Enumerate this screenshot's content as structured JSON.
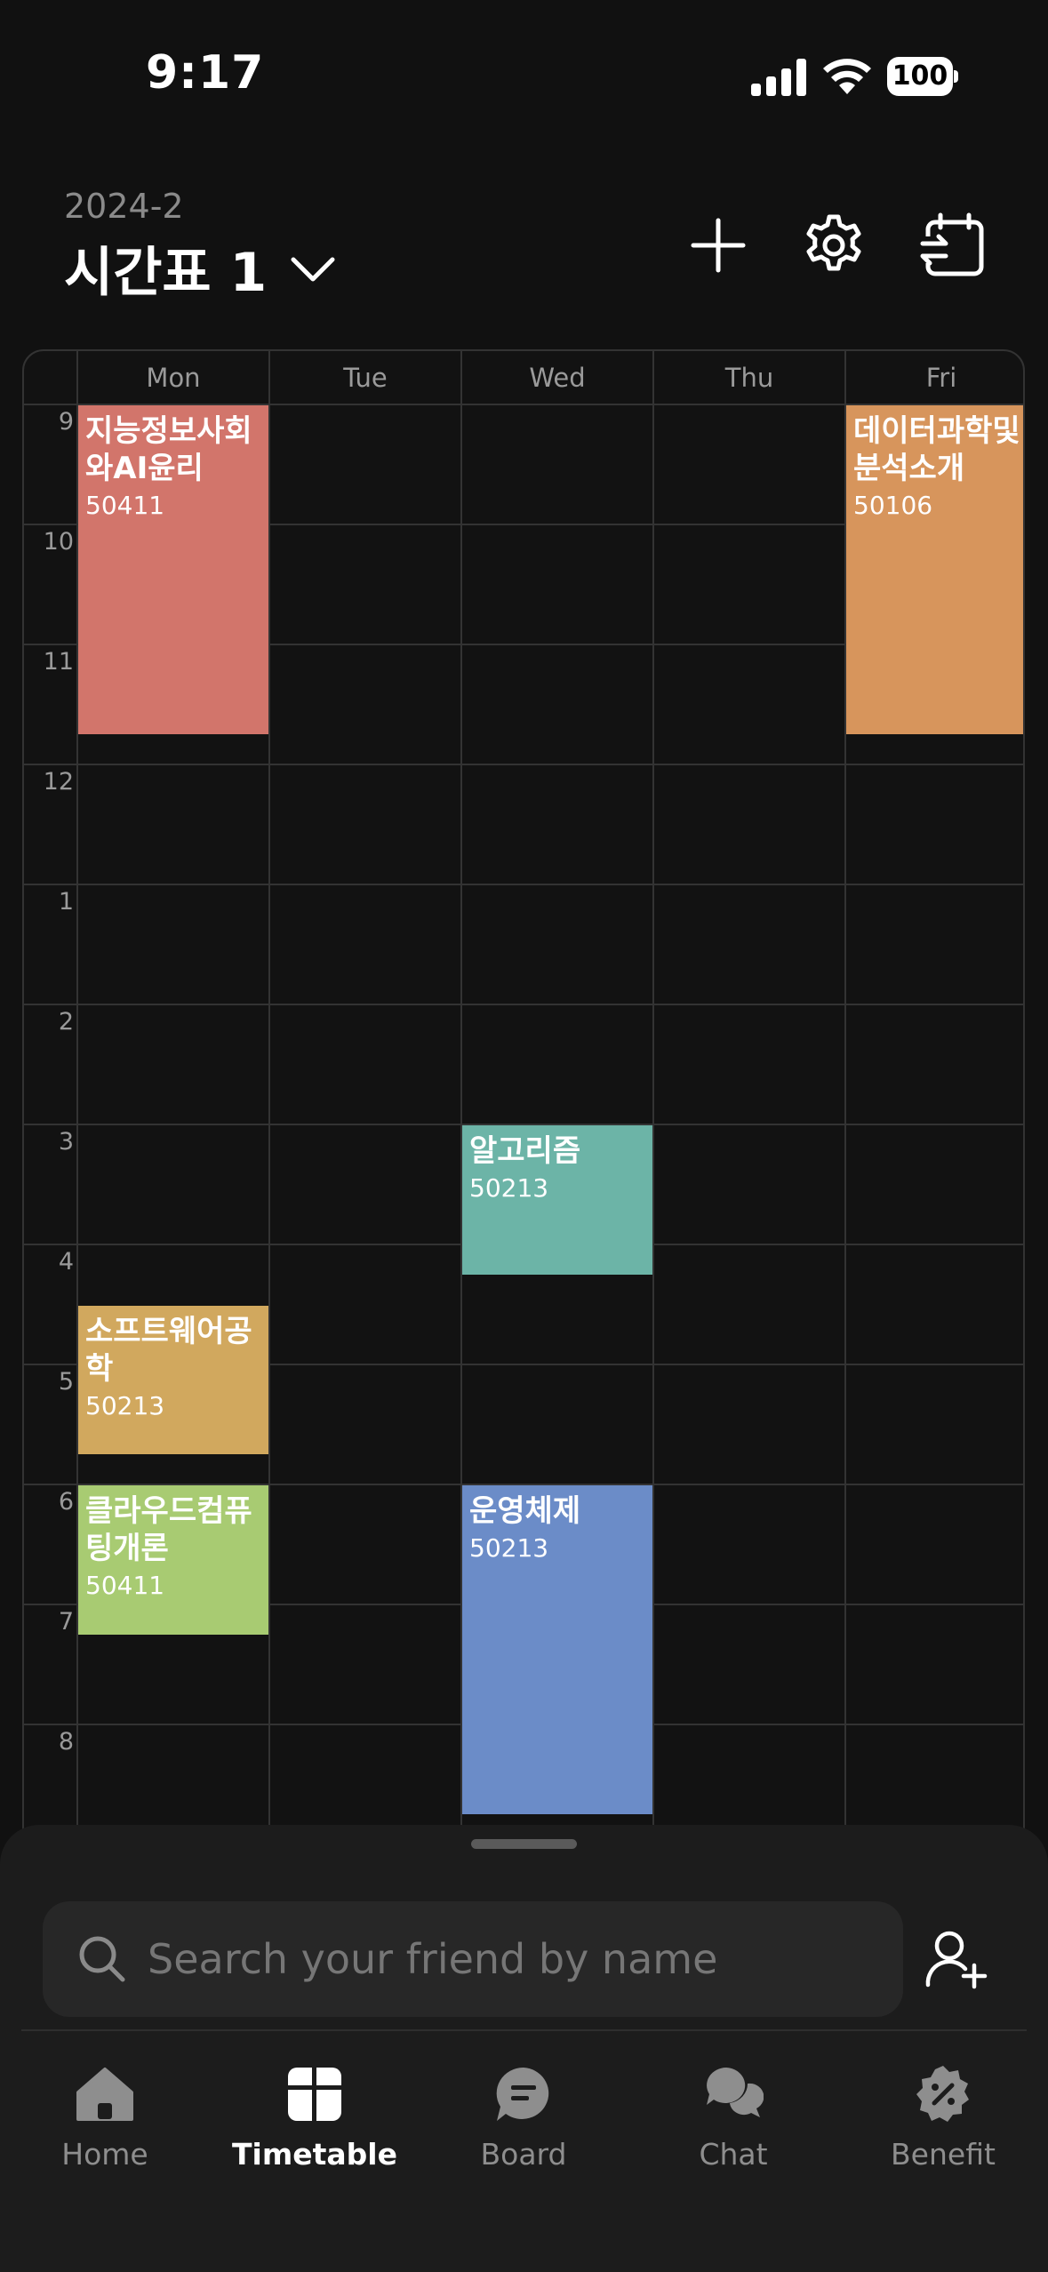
{
  "status_bar": {
    "time": "9:17",
    "battery": "100"
  },
  "header": {
    "semester": "2024-2",
    "title": "시간표 1"
  },
  "timetable": {
    "days": [
      "Mon",
      "Tue",
      "Wed",
      "Thu",
      "Fri"
    ],
    "hours": [
      "9",
      "10",
      "11",
      "12",
      "1",
      "2",
      "3",
      "4",
      "5",
      "6",
      "7",
      "8"
    ],
    "classes": [
      {
        "name": "지능정보사회와AI윤리",
        "room": "50411",
        "day": "Mon",
        "start": "9:00",
        "end": "11:45",
        "color": "#d2756b"
      },
      {
        "name": "데이터과학및분석소개",
        "room": "50106",
        "day": "Fri",
        "start": "9:00",
        "end": "11:45",
        "color": "#d7955c"
      },
      {
        "name": "알고리즘",
        "room": "50213",
        "day": "Wed",
        "start": "15:00",
        "end": "16:15",
        "color": "#6cb4a7"
      },
      {
        "name": "소프트웨어공학",
        "room": "50213",
        "day": "Mon",
        "start": "16:30",
        "end": "17:45",
        "color": "#d1a85e"
      },
      {
        "name": "클라우드컴퓨팅개론",
        "room": "50411",
        "day": "Mon",
        "start": "18:00",
        "end": "19:15",
        "color": "#a8cb72"
      },
      {
        "name": "운영체제",
        "room": "50213",
        "day": "Wed",
        "start": "18:00",
        "end": "20:45",
        "color": "#6b8cc8"
      }
    ]
  },
  "search": {
    "placeholder": "Search your friend by name"
  },
  "tabbar": {
    "items": [
      {
        "label": "Home",
        "icon": "home-icon",
        "active": false
      },
      {
        "label": "Timetable",
        "icon": "timetable-icon",
        "active": true
      },
      {
        "label": "Board",
        "icon": "board-icon",
        "active": false
      },
      {
        "label": "Chat",
        "icon": "chat-icon",
        "active": false
      },
      {
        "label": "Benefit",
        "icon": "benefit-icon",
        "active": false
      }
    ]
  },
  "colors": {
    "background": "#111111",
    "sheet": "#1c1c1c",
    "grid_line": "#333333",
    "muted_text": "#8e8e8e"
  }
}
